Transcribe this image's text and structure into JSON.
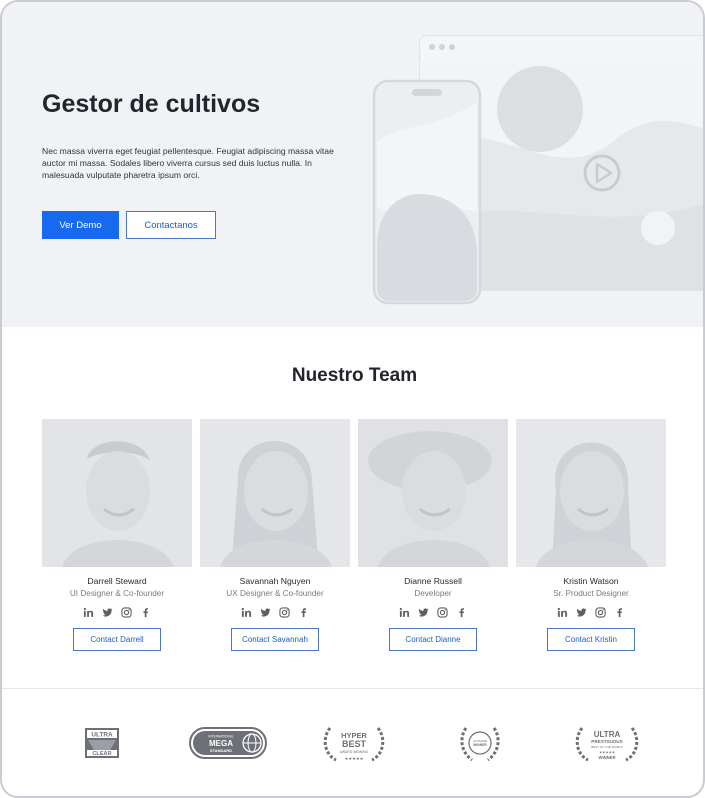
{
  "hero": {
    "title": "Gestor de cultivos",
    "description": "Nec massa viverra eget feugiat pellentesque. Feugiat adipiscing massa vitae auctor mi massa. Sodales libero viverra cursus sed duis luctus nulla. In malesuada vulputate pharetra ipsum orci.",
    "primary_button": "Ver Demo",
    "secondary_button": "Contactanos"
  },
  "team": {
    "title": "Nuestro Team",
    "members": [
      {
        "name": "Darrell Steward",
        "role": "UI Designer & Co-founder",
        "contact": "Contact Darrell"
      },
      {
        "name": "Savannah Nguyen",
        "role": "UX Designer & Co-founder",
        "contact": "Contact Savannah"
      },
      {
        "name": "Dianne Russell",
        "role": "Developer",
        "contact": "Contact Dianne"
      },
      {
        "name": "Kristin Watson",
        "role": "Sr. Product Designer",
        "contact": "Contact Kristin"
      }
    ],
    "social_icons": [
      "linkedin-icon",
      "twitter-icon",
      "instagram-icon",
      "facebook-icon"
    ]
  },
  "awards": {
    "logos": [
      {
        "lines": [
          "ULTRA",
          "CLEAR"
        ]
      },
      {
        "lines": [
          "INTERNATIONAL",
          "MEGA",
          "STANDARD"
        ]
      },
      {
        "lines": [
          "HYPER",
          "BEST",
          "AWARD WINNING"
        ]
      },
      {
        "lines": [
          "ULTIMATE",
          "WINNER"
        ]
      },
      {
        "lines": [
          "ULTRA",
          "PRESTIGIOUS",
          "BEST OF THE WORLD",
          "WINNER"
        ]
      }
    ]
  },
  "colors": {
    "accent": "#1769f0",
    "hero_bg": "#f1f2f5",
    "placeholder": "#d8dadf"
  }
}
